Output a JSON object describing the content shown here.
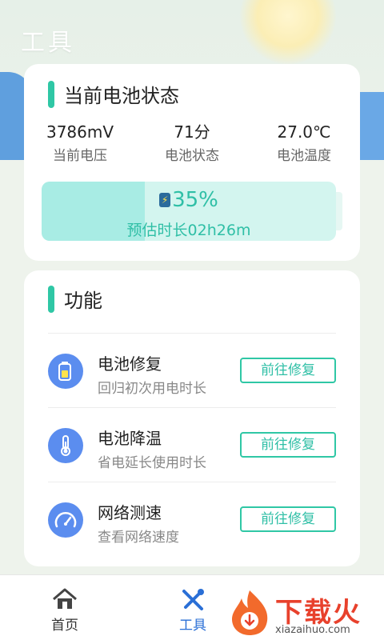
{
  "header": {
    "title": "工具"
  },
  "status_card": {
    "title": "当前电池状态",
    "stats": [
      {
        "value": "3786mV",
        "label": "当前电压"
      },
      {
        "value": "71分",
        "label": "电池状态"
      },
      {
        "value": "27.0℃",
        "label": "电池温度"
      }
    ],
    "battery": {
      "percent_text": "35%",
      "level": 0.35,
      "estimate": "预估时长02h26m"
    }
  },
  "function_card": {
    "title": "功能",
    "items": [
      {
        "name": "电池修复",
        "desc": "回归初次用电时长",
        "button": "前往修复",
        "icon": "battery-icon"
      },
      {
        "name": "电池降温",
        "desc": "省电延长使用时长",
        "button": "前往修复",
        "icon": "thermometer-icon"
      },
      {
        "name": "网络测速",
        "desc": "查看网络速度",
        "button": "前往修复",
        "icon": "speedometer-icon"
      }
    ]
  },
  "tabbar": {
    "tabs": [
      {
        "label": "首页",
        "icon": "home-icon"
      },
      {
        "label": "工具",
        "icon": "tools-icon",
        "active": true
      }
    ]
  },
  "watermark": {
    "text": "下载火",
    "url": "xiazaihuo.com"
  },
  "colors": {
    "accent": "#2fc7a5",
    "icon_blue": "#5b8def",
    "active_tab": "#2a6fd6",
    "watermark_red": "#e8412c"
  }
}
